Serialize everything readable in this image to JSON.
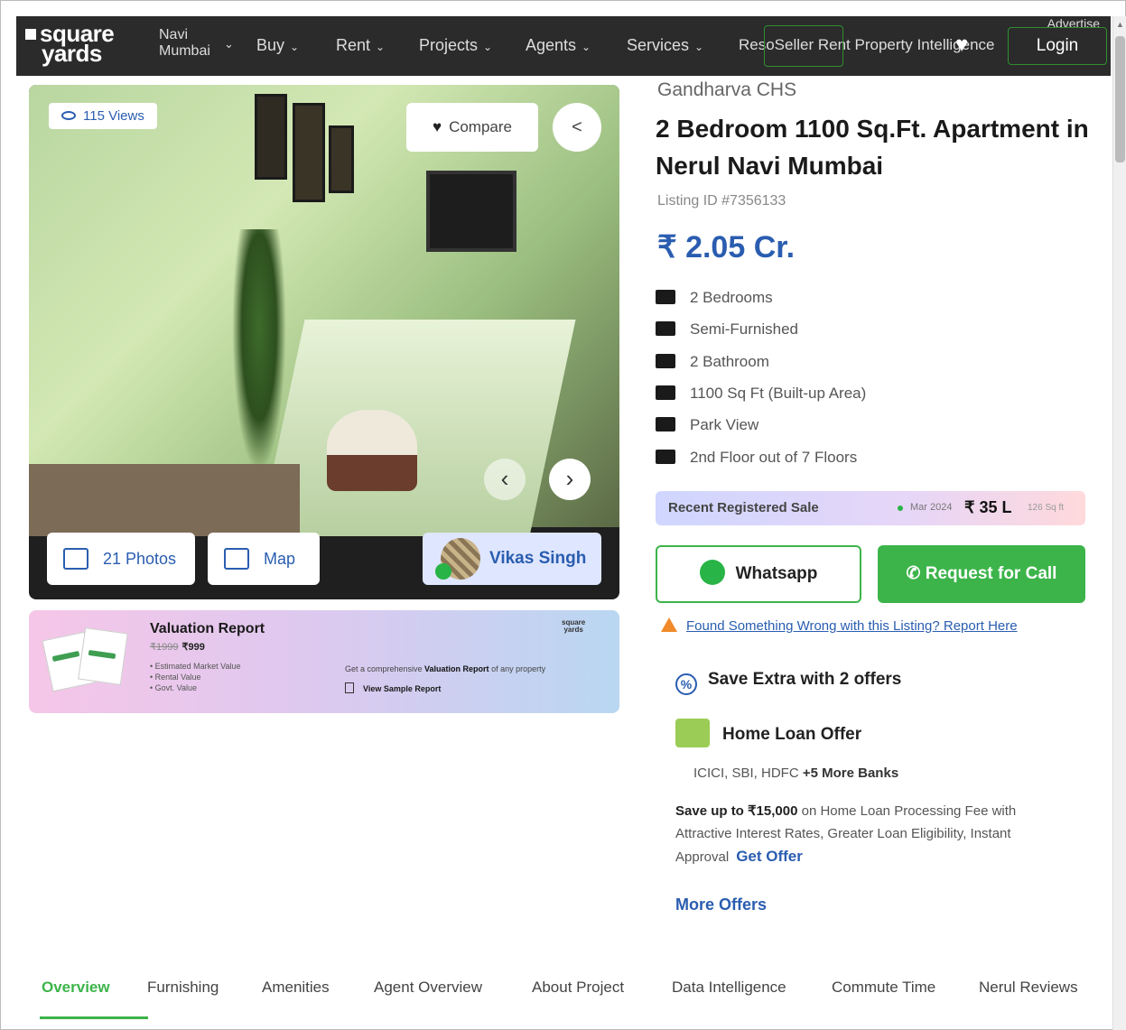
{
  "nav": {
    "logo_line1": "square",
    "logo_line2": "yards",
    "city_line1": "Navi",
    "city_line2": "Mumbai",
    "items": [
      "Buy",
      "Rent",
      "Projects",
      "Agents",
      "Services"
    ],
    "overlap_text": "ResoSeller Rent Property Intelligence",
    "advertise": "Advertise with us",
    "login": "Login"
  },
  "gallery": {
    "views": "115 Views",
    "compare": "Compare",
    "photos": "21 Photos",
    "map": "Map",
    "agent_name": "Vikas Singh",
    "prev_glyph": "‹",
    "next_glyph": "›"
  },
  "valuation": {
    "title": "Valuation Report",
    "old_price": "₹1999",
    "new_price": "₹999",
    "points": [
      "Estimated Market Value",
      "Rental Value",
      "Govt. Value"
    ],
    "desc_pre": "Get a comprehensive ",
    "desc_bold": "Valuation Report",
    "desc_post": " of any property",
    "sample": "View Sample Report",
    "logo_line1": "square",
    "logo_line2": "yards"
  },
  "listing": {
    "society": "Gandharva CHS",
    "title": "2 Bedroom 1100 Sq.Ft. Apartment in Nerul Navi Mumbai",
    "listing_id": "Listing ID #7356133",
    "price": "₹ 2.05 Cr.",
    "features": [
      "2 Bedrooms",
      "Semi-Furnished",
      "2 Bathroom",
      "1100 Sq Ft (Built-up Area)",
      "Park View",
      "2nd Floor out of 7 Floors"
    ]
  },
  "recent_sale": {
    "label": "Recent Registered Sale",
    "date": "Mar 2024",
    "amount": "₹ 35 L",
    "size": "126 Sq ft"
  },
  "actions": {
    "whatsapp": "Whatsapp",
    "call": "Request for Call",
    "report": "Found Something Wrong with this Listing? Report Here"
  },
  "offers": {
    "heading": "Save Extra with 2 offers",
    "home_loan": "Home Loan Offer",
    "banks": "ICICI, SBI, HDFC",
    "banks_more": "+5 More Banks",
    "save_bold": "Save up to ₹15,000",
    "save_rest": " on Home Loan Processing Fee with Attractive Interest Rates, Greater Loan Eligibility, Instant Approval",
    "get_offer": "Get Offer",
    "more_offers": "More Offers"
  },
  "tabs": [
    "Overview",
    "Furnishing",
    "Amenities",
    "Agent Overview",
    "About Project",
    "Data Intelligence",
    "Commute Time",
    "Nerul Reviews"
  ],
  "colors": {
    "accent_blue": "#2a5db0",
    "accent_green": "#3cb44a",
    "nav_bg": "#2b2b2b"
  }
}
